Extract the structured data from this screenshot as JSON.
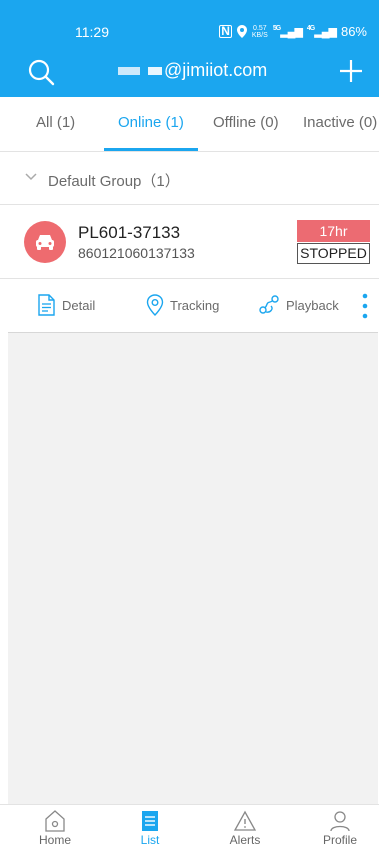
{
  "status_bar": {
    "time": "11:29",
    "nfc": "N",
    "speed_top": "0.57",
    "speed_bottom": "KB/S",
    "signal1": "5G",
    "signal2": "4G",
    "battery": "86%"
  },
  "header": {
    "account_suffix": "@jimiiot.com",
    "search_icon": "search-icon",
    "add_icon": "plus-icon"
  },
  "tabs": [
    {
      "label": "All (1)"
    },
    {
      "label": "Online (1)",
      "active": true
    },
    {
      "label": "Offline (0)"
    },
    {
      "label": "Inactive (0)"
    }
  ],
  "group": {
    "label": "Default Group（1）",
    "icon": "chevron-down-icon"
  },
  "device": {
    "name": "PL601-37133",
    "imei": "860121060137133",
    "duration": "17hr",
    "state": "STOPPED",
    "icon": "car-icon"
  },
  "actions": {
    "detail": "Detail",
    "tracking": "Tracking",
    "playback": "Playback"
  },
  "bottom_nav": [
    {
      "label": "Home",
      "icon": "home-icon"
    },
    {
      "label": "List",
      "icon": "list-icon",
      "active": true
    },
    {
      "label": "Alerts",
      "icon": "alert-icon"
    },
    {
      "label": "Profile",
      "icon": "profile-icon"
    }
  ],
  "colors": {
    "accent": "#1ba6ef",
    "stopped": "#ec6b72",
    "avatar": "#ee6b6f"
  }
}
